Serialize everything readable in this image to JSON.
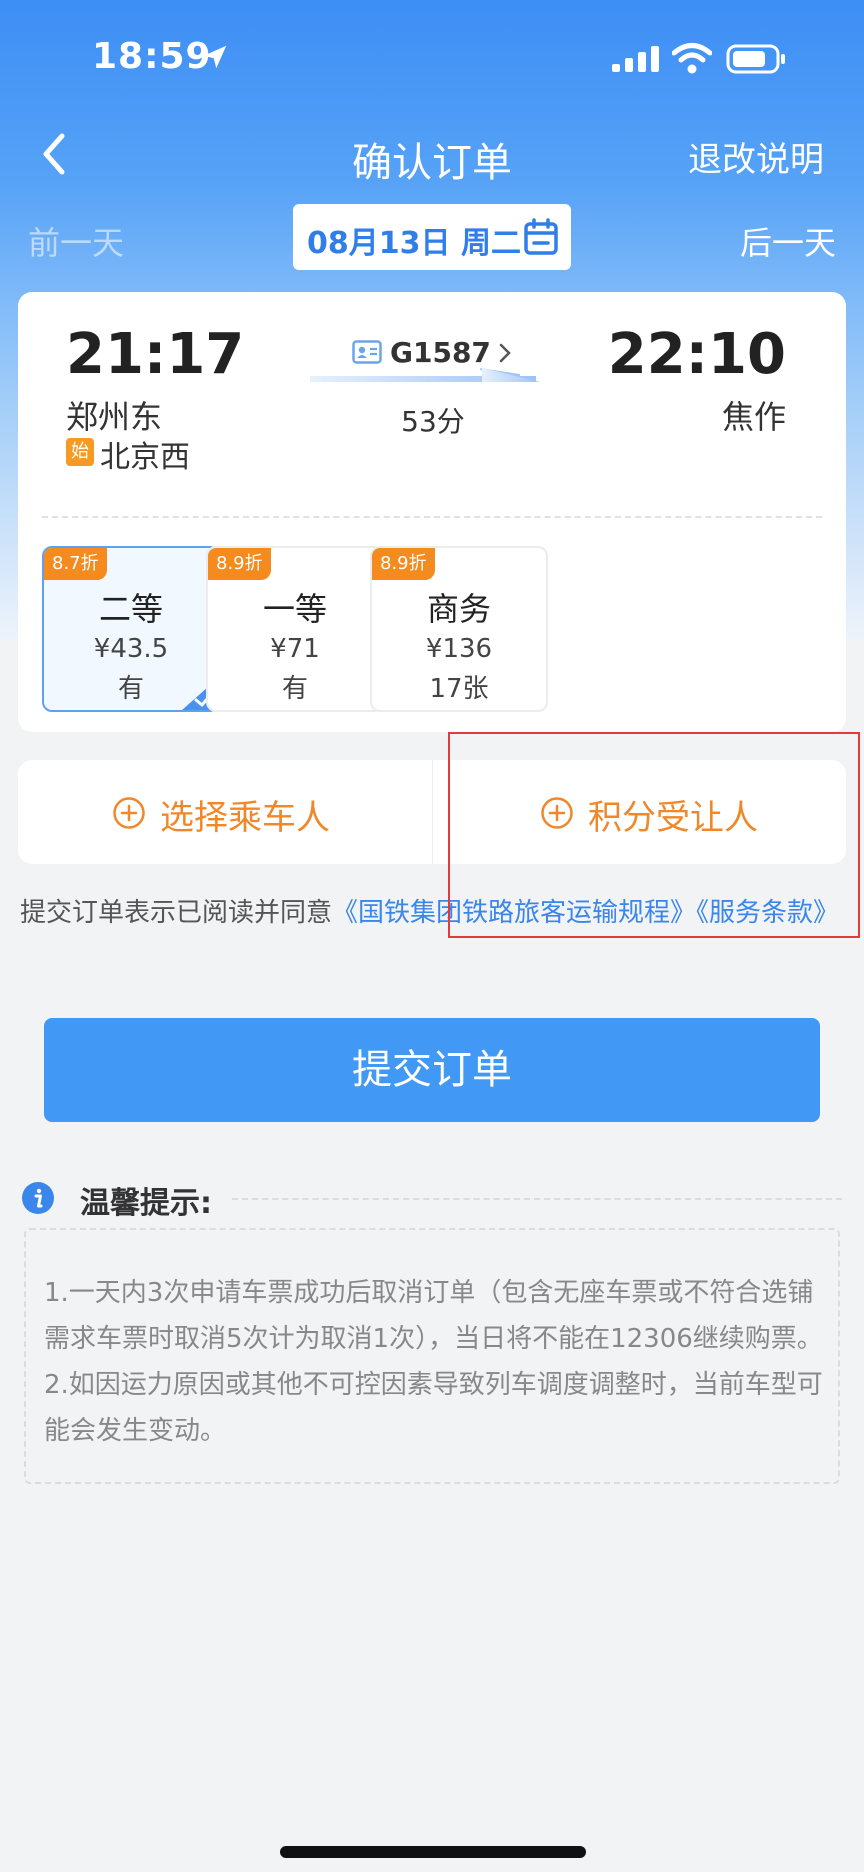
{
  "status_bar": {
    "time": "18:59"
  },
  "nav": {
    "title": "确认订单",
    "right_label": "退改说明"
  },
  "date_bar": {
    "prev_label": "前一天",
    "date": "08月13日 周二",
    "next_label": "后一天"
  },
  "train": {
    "dep_time": "21:17",
    "dep_station": "郑州东",
    "origin_badge": "始",
    "origin_station": "北京西",
    "train_no": "G1587",
    "duration": "53分",
    "arr_time": "22:10",
    "arr_station": "焦作"
  },
  "seats": [
    {
      "discount": "8.7折",
      "name": "二等",
      "price": "¥43.5",
      "availability": "有",
      "selected": true
    },
    {
      "discount": "8.9折",
      "name": "一等",
      "price": "¥71",
      "availability": "有",
      "selected": false
    },
    {
      "discount": "8.9折",
      "name": "商务",
      "price": "¥136",
      "availability": "17张",
      "selected": false
    }
  ],
  "passenger": {
    "select_label": "选择乘车人",
    "points_label": "积分受让人"
  },
  "agreement": {
    "prefix": "提交订单表示已阅读并同意",
    "link1": "《国铁集团铁路旅客运输规程》",
    "link2": "《服务条款》"
  },
  "submit_label": "提交订单",
  "tips": {
    "title": "温馨提示:",
    "items": [
      "1.一天内3次申请车票成功后取消订单（包含无座车票或不符合选铺需求车票时取消5次计为取消1次），当日将不能在12306继续购票。",
      "2.如因运力原因或其他不可控因素导致列车调度调整时，当前车型可能会发生变动。"
    ]
  },
  "colors": {
    "primary": "#4199f5",
    "accent_orange": "#f0882a",
    "highlight_red": "#e23b3b"
  }
}
